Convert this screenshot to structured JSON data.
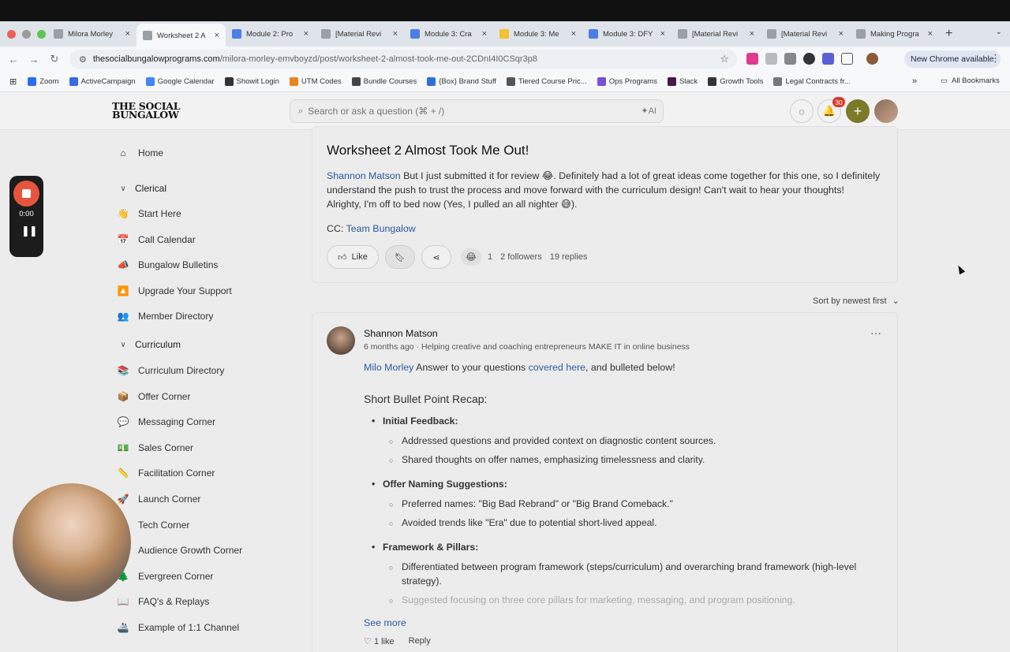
{
  "browser": {
    "tabs": [
      {
        "label": "Milora Morley",
        "color": "#9aa0a6",
        "active": false
      },
      {
        "label": "Worksheet 2 A",
        "color": "#9aa0a6",
        "active": true
      },
      {
        "label": "Module 2: Pro",
        "color": "#4a7ee8",
        "active": false
      },
      {
        "label": "[Material Revi",
        "color": "#9aa0a6",
        "active": false
      },
      {
        "label": "Module 3: Cra",
        "color": "#4a7ee8",
        "active": false
      },
      {
        "label": "Module 3: Me",
        "color": "#f2c232",
        "active": false
      },
      {
        "label": "Module 3: DFY",
        "color": "#4a7ee8",
        "active": false
      },
      {
        "label": "[Material Revi",
        "color": "#9aa0a6",
        "active": false
      },
      {
        "label": "[Material Revi",
        "color": "#9aa0a6",
        "active": false
      },
      {
        "label": "Making Progra",
        "color": "#9aa0a6",
        "active": false
      }
    ],
    "url_host": "thesocialbungalowprograms.com",
    "url_path": "/milora-morley-emvboyzd/post/worksheet-2-almost-took-me-out-2CDnI4I0CSqr3p8",
    "new_chrome": "New Chrome available",
    "bookmarks": [
      {
        "label": "Zoom",
        "color": "#2d6cf0"
      },
      {
        "label": "ActiveCampaign",
        "color": "#356ae6"
      },
      {
        "label": "Google Calendar",
        "color": "#4285f4"
      },
      {
        "label": "Showit Login",
        "color": "#333333"
      },
      {
        "label": "UTM Codes",
        "color": "#e8841c"
      },
      {
        "label": "Bundle Courses",
        "color": "#444444"
      },
      {
        "label": "{Box} Brand Stuff",
        "color": "#2f6fdc"
      },
      {
        "label": "Tiered Course Pric...",
        "color": "#555555"
      },
      {
        "label": "Ops Programs",
        "color": "#7a4fd6"
      },
      {
        "label": "Slack",
        "color": "#4a154b"
      },
      {
        "label": "Growth Tools",
        "color": "#333333"
      },
      {
        "label": "Legal Contracts fr...",
        "color": "#777777"
      }
    ],
    "all_bookmarks": "All Bookmarks"
  },
  "site": {
    "logo_line1": "THE SOCIAL",
    "logo_line2": "BUNGALOW",
    "search_placeholder": "Search or ask a question (⌘ + /)",
    "search_ai": "✦AI",
    "notification_count": "30"
  },
  "sidebar": {
    "home": "Home",
    "section_clerical": "Clerical",
    "clerical_items": [
      {
        "icon": "👋",
        "label": "Start Here"
      },
      {
        "icon": "📅",
        "label": "Call Calendar"
      },
      {
        "icon": "📣",
        "label": "Bungalow Bulletins"
      },
      {
        "icon": "🔼",
        "label": "Upgrade Your Support"
      },
      {
        "icon": "👥",
        "label": "Member Directory"
      }
    ],
    "section_curriculum": "Curriculum",
    "curriculum_items": [
      {
        "icon": "📚",
        "label": "Curriculum Directory"
      },
      {
        "icon": "📦",
        "label": "Offer Corner"
      },
      {
        "icon": "💬",
        "label": "Messaging Corner"
      },
      {
        "icon": "💵",
        "label": "Sales Corner"
      },
      {
        "icon": "📏",
        "label": "Facilitation Corner"
      },
      {
        "icon": "🚀",
        "label": "Launch Corner"
      },
      {
        "icon": "💻",
        "label": "Tech Corner"
      },
      {
        "icon": "📈",
        "label": "Audience Growth Corner"
      },
      {
        "icon": "🌲",
        "label": "Evergreen Corner"
      },
      {
        "icon": "📖",
        "label": "FAQ's & Replays"
      },
      {
        "icon": "🚢",
        "label": "Example of 1:1 Channel"
      }
    ]
  },
  "recorder": {
    "time": "0:00"
  },
  "post": {
    "title": "Worksheet 2 Almost Took Me Out!",
    "mention": "Shannon Matson",
    "body_line1": " But I just submitted it for review 😂. Definitely had a lot of great ideas come together for this one, so I definitely",
    "body_line2": "understand the push to trust the process and move forward with the curriculum design! Can't wait to hear your thoughts!",
    "body_line3": "Alrighty, I'm off to bed now (Yes, I pulled an all nighter 😅).",
    "cc_label": "CC: ",
    "cc_mention": "Team Bungalow",
    "like_label": "Like",
    "reaction_emoji": "😂",
    "reaction_count": "1",
    "followers": "2 followers",
    "replies": "19 replies"
  },
  "sort_label": "Sort by newest first",
  "reply": {
    "author": "Shannon Matson",
    "meta": "6 months ago · Helping creative and coaching entrepreneurs MAKE IT in online business",
    "mention": "Milo Morley",
    "intro_text": " Answer to your questions ",
    "intro_link": "covered here",
    "intro_end": ", and bulleted below!",
    "heading": "Short Bullet Point Recap:",
    "b1_title": "Initial Feedback",
    "b1_items": [
      "Addressed questions and provided context on diagnostic content sources.",
      "Shared thoughts on offer names, emphasizing timelessness and clarity."
    ],
    "b2_title": "Offer Naming Suggestions",
    "b2_items": [
      "Preferred names: \"Big Bad Rebrand\" or \"Big Brand Comeback.\"",
      "Avoided trends like \"Era\" due to potential short-lived appeal."
    ],
    "b3_title": "Framework & Pillars",
    "b3_items": [
      "Differentiated between program framework (steps/curriculum) and overarching brand framework (high-level strategy).",
      "Suggested focusing on three core pillars for marketing, messaging, and program positioning."
    ],
    "see_more": "See more",
    "likes": "1 like",
    "reply_label": "Reply"
  }
}
